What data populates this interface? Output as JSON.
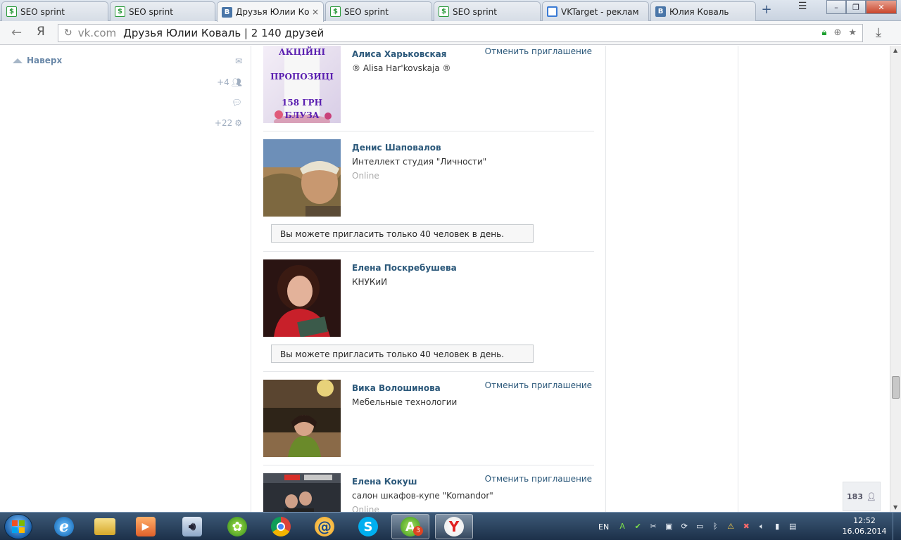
{
  "browser": {
    "tabs": [
      {
        "label": "SEO sprint",
        "favicon": "seo",
        "active": false
      },
      {
        "label": "SEO sprint",
        "favicon": "seo",
        "active": false
      },
      {
        "label": "Друзья Юлии Кова",
        "favicon": "vk",
        "active": true,
        "close": "×"
      },
      {
        "label": "SEO sprint",
        "favicon": "seo",
        "active": false
      },
      {
        "label": "SEO sprint",
        "favicon": "seo",
        "active": false
      },
      {
        "label": "VKTarget - реклам",
        "favicon": "vktarget",
        "active": false
      },
      {
        "label": "Юлия Коваль",
        "favicon": "vk",
        "active": false
      }
    ],
    "new_tab": "+",
    "address": {
      "domain": "vk.com",
      "title": "Друзья Юлии Коваль | 2 140 друзей"
    },
    "yandex_button": "Я"
  },
  "sidebar": {
    "top_link": "Наверх",
    "counters": {
      "friends": "+4",
      "notifications": "+22"
    }
  },
  "friends": [
    {
      "name": "Алиса Харьковская",
      "subtitle": "® Alisa Har'kovskaja ®",
      "online": "",
      "cancel": "Отменить приглашение",
      "notice": "",
      "photo_text": [
        "АКЦІЙНІ",
        "ПРОПОЗИЦІ",
        "158 ГРН",
        "БЛУЗА"
      ]
    },
    {
      "name": "Денис Шаповалов",
      "subtitle": "Интеллект студия \"Личности\"",
      "online": "Online",
      "cancel": "",
      "notice": "Вы можете пригласить только 40 человек в день."
    },
    {
      "name": "Елена Поскребушева",
      "subtitle": "КНУКиИ",
      "online": "",
      "cancel": "",
      "notice": "Вы можете пригласить только 40 человек в день."
    },
    {
      "name": "Вика Волошинова",
      "subtitle": "Мебельные технологии",
      "online": "",
      "cancel": "Отменить приглашение",
      "notice": ""
    },
    {
      "name": "Елена Кокуш",
      "subtitle": "салон шкафов-купе \"Komandor\"",
      "online": "Online",
      "cancel": "Отменить приглашение",
      "notice": ""
    }
  ],
  "online_count": "183",
  "taskbar": {
    "badge": "3",
    "lang": "EN",
    "time": "12:52",
    "date": "16.06.2014"
  },
  "colors": {
    "vk_link": "#2b587a",
    "accent": "#4a76a8"
  }
}
